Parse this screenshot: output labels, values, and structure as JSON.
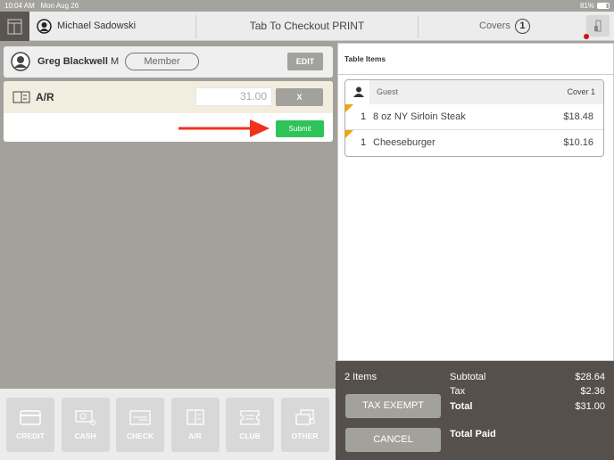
{
  "status": {
    "time": "10:04 AM",
    "date": "Mon Aug 26",
    "battery": "81%"
  },
  "header": {
    "server": "Michael Sadowski",
    "title": "Tab To Checkout PRINT",
    "covers_label": "Covers",
    "covers": "1"
  },
  "customer": {
    "name": "Greg Blackwell",
    "suffix": "M",
    "badge": "Member",
    "edit": "EDIT"
  },
  "payment": {
    "method": "A/R",
    "amount": "31.00",
    "remove": "X",
    "submit": "Submit"
  },
  "payment_types": [
    {
      "label": "CREDIT",
      "icon": "credit-card-icon"
    },
    {
      "label": "CASH",
      "icon": "cash-icon"
    },
    {
      "label": "CHECK",
      "icon": "check-icon"
    },
    {
      "label": "A/R",
      "icon": "ar-book-icon"
    },
    {
      "label": "CLUB",
      "icon": "club-ticket-icon"
    },
    {
      "label": "OTHER",
      "icon": "other-cards-icon"
    }
  ],
  "table": {
    "title": "Table Items",
    "guest_label": "Guest",
    "cover": "Cover 1",
    "items": [
      {
        "qty": "1",
        "name": "8 oz NY Sirloin Steak",
        "price": "$18.48"
      },
      {
        "qty": "1",
        "name": "Cheeseburger",
        "price": "$10.16"
      }
    ]
  },
  "totals": {
    "count": "2 Items",
    "subtotal_label": "Subtotal",
    "subtotal": "$28.64",
    "tax_label": "Tax",
    "tax": "$2.36",
    "total_label": "Total",
    "total": "$31.00",
    "paid_label": "Total Paid",
    "tax_exempt": "TAX EXEMPT",
    "cancel": "CANCEL"
  },
  "colors": {
    "submit": "#2fc35a",
    "arrow": "#f0321e",
    "flag": "#f0a800",
    "dark": "#55504b"
  }
}
